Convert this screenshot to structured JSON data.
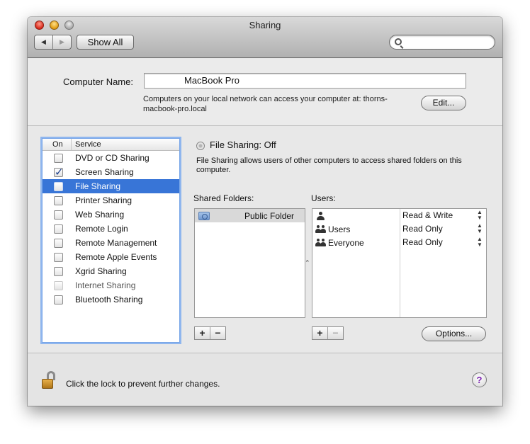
{
  "window": {
    "title": "Sharing"
  },
  "toolbar": {
    "back_glyph": "◀",
    "forward_glyph": "▶",
    "show_all_label": "Show All",
    "search_placeholder": ""
  },
  "computer_name": {
    "label": "Computer Name:",
    "value": "MacBook Pro",
    "description": "Computers on your local network can access your computer at: thorns-macbook-pro.local",
    "edit_label": "Edit..."
  },
  "services": {
    "header_on": "On",
    "header_service": "Service",
    "items": [
      {
        "label": "DVD or CD Sharing",
        "checked": false,
        "selected": false,
        "faded": false
      },
      {
        "label": "Screen Sharing",
        "checked": true,
        "selected": false,
        "faded": false
      },
      {
        "label": "File Sharing",
        "checked": false,
        "selected": true,
        "faded": false
      },
      {
        "label": "Printer Sharing",
        "checked": false,
        "selected": false,
        "faded": false
      },
      {
        "label": "Web Sharing",
        "checked": false,
        "selected": false,
        "faded": false
      },
      {
        "label": "Remote Login",
        "checked": false,
        "selected": false,
        "faded": false
      },
      {
        "label": "Remote Management",
        "checked": false,
        "selected": false,
        "faded": false
      },
      {
        "label": "Remote Apple Events",
        "checked": false,
        "selected": false,
        "faded": false
      },
      {
        "label": "Xgrid Sharing",
        "checked": false,
        "selected": false,
        "faded": false
      },
      {
        "label": "Internet Sharing",
        "checked": false,
        "selected": false,
        "faded": true
      },
      {
        "label": "Bluetooth Sharing",
        "checked": false,
        "selected": false,
        "faded": false
      }
    ]
  },
  "file_sharing": {
    "status": "File Sharing: Off",
    "description": "File Sharing allows users of other computers to access shared folders on this computer.",
    "shared_folders_label": "Shared Folders:",
    "users_label": "Users:",
    "folders": [
      {
        "name": "Public Folder"
      }
    ],
    "users": [
      {
        "name": "",
        "permission": "Read & Write",
        "icon": "person-icon"
      },
      {
        "name": "Users",
        "permission": "Read Only",
        "icon": "group-icon"
      },
      {
        "name": "Everyone",
        "permission": "Read Only",
        "icon": "group-icon"
      }
    ],
    "add_glyph": "+",
    "remove_glyph": "−",
    "options_label": "Options...",
    "stepper_glyph": "▲\n▼",
    "grip_glyph": "⌃"
  },
  "footer": {
    "lock_text": "Click the lock to prevent further changes.",
    "help_glyph": "?"
  },
  "colors": {
    "selection": "#3875d7",
    "focus_ring": "#8fb6ee",
    "help_mark": "#7a1fb0"
  }
}
